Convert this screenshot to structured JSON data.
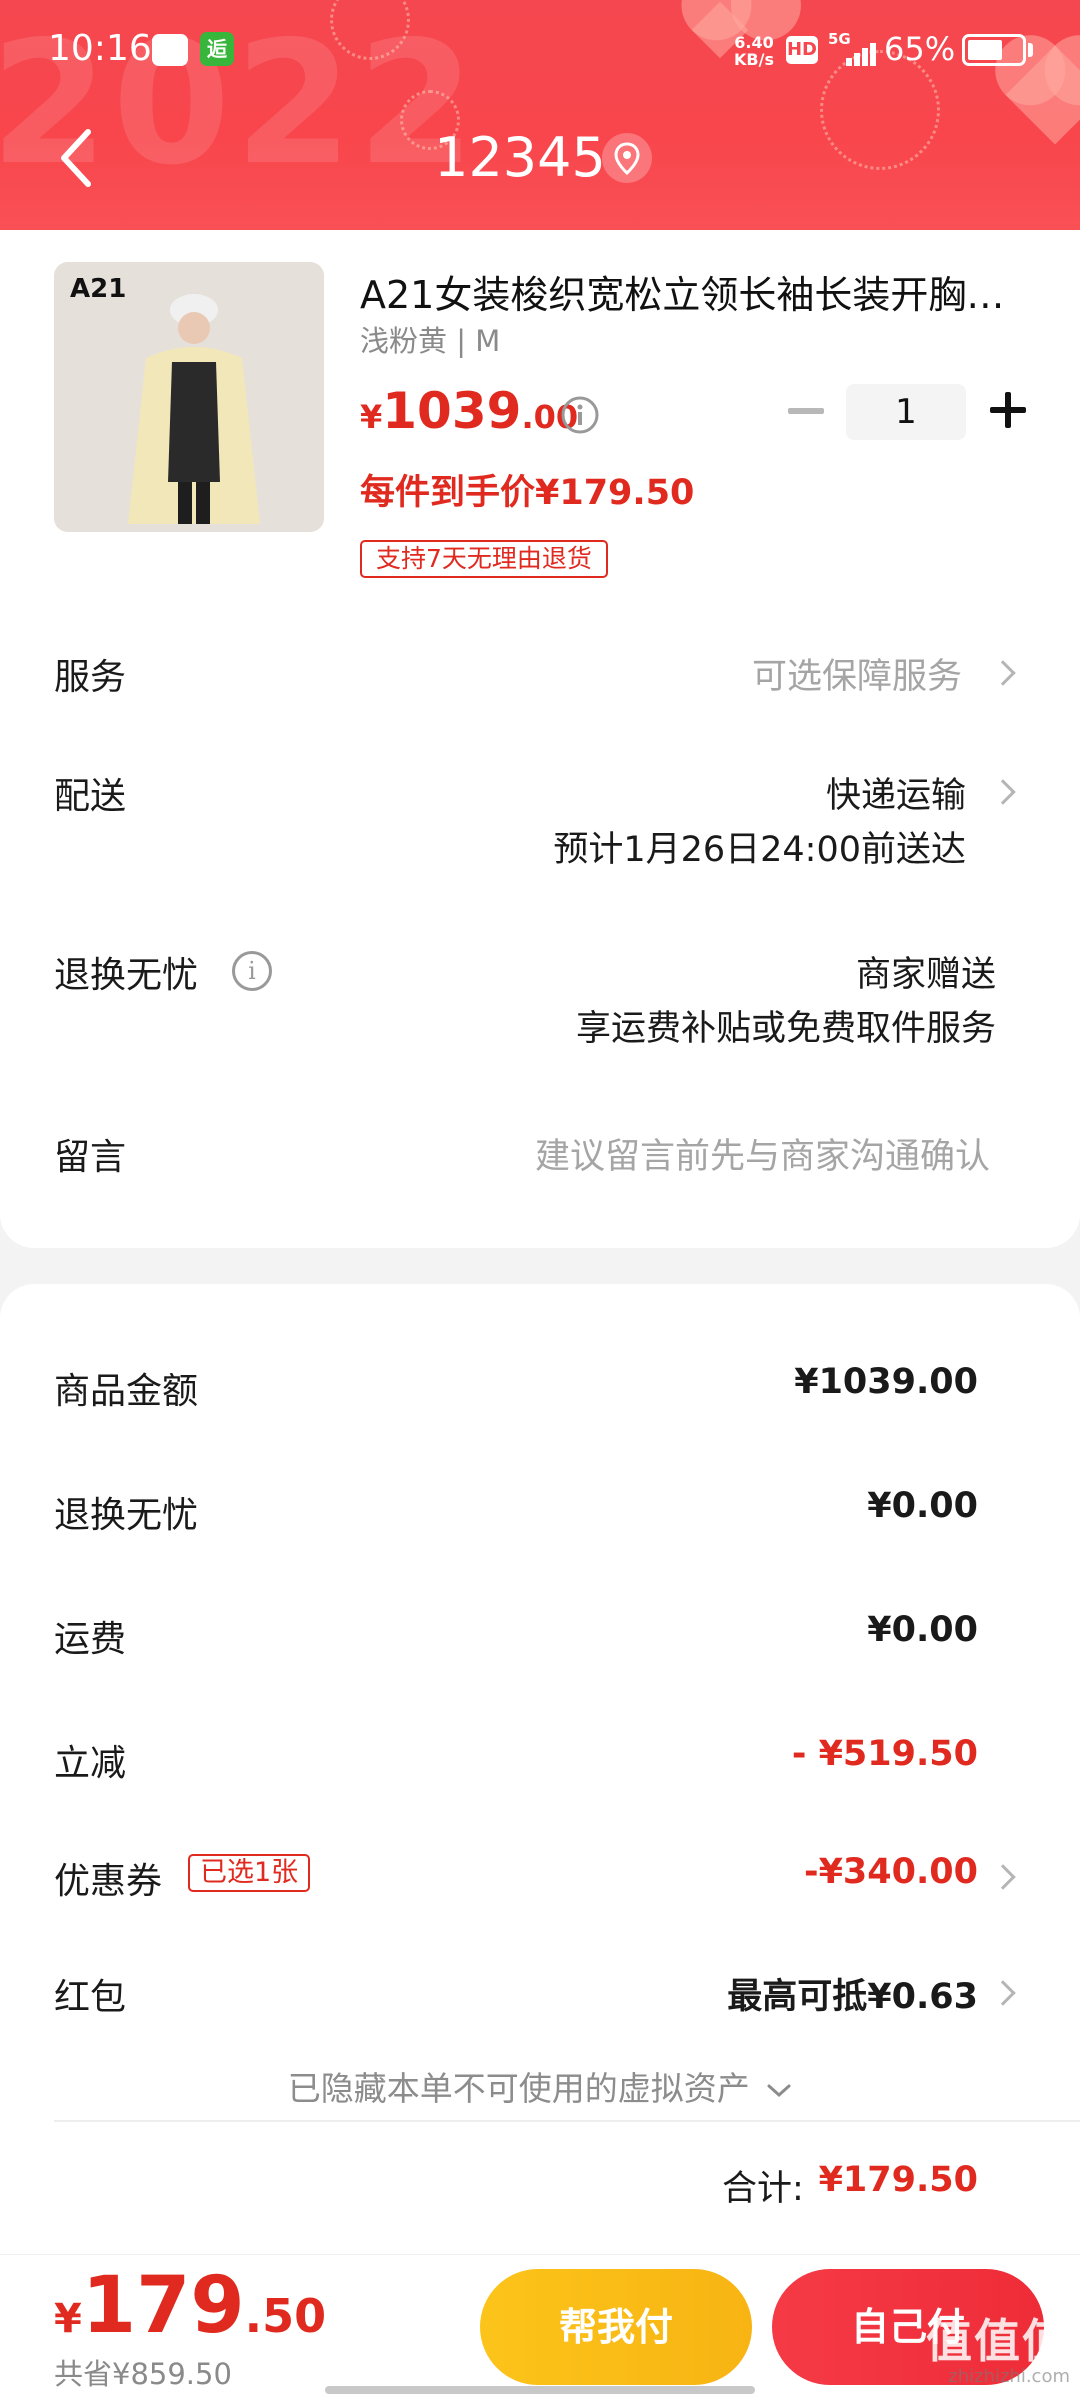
{
  "status_bar": {
    "time": "10:16",
    "speed_value": "6.40",
    "speed_unit": "KB/s",
    "hd": "HD",
    "network": "5G",
    "battery_pct": "65%",
    "battery_level": 0.65,
    "app2_label": "逅"
  },
  "header": {
    "title": "12345",
    "deco_text": "2022"
  },
  "product": {
    "brand_on_image": "A21",
    "title": "A21女装梭织宽松立领长袖长装开胸…",
    "spec": "浅粉黄 | M",
    "price_symbol": "¥",
    "price_int": "1039",
    "price_dec": ".00",
    "quantity": "1",
    "each_price": "每件到手价¥179.50",
    "return_tag": "支持7天无理由退货"
  },
  "options": {
    "service_label": "服务",
    "service_value": "可选保障服务",
    "delivery_label": "配送",
    "delivery_value": "快递运输",
    "delivery_eta": "预计1月26日24:00前送达",
    "worry_free_label": "退换无忧",
    "worry_free_value": "商家赠送",
    "worry_free_sub": "享运费补贴或免费取件服务",
    "message_label": "留言",
    "message_placeholder": "建议留言前先与商家沟通确认"
  },
  "summary": {
    "goods_label": "商品金额",
    "goods_value": "¥1039.00",
    "worry_label": "退换无忧",
    "worry_value": "¥0.00",
    "shipping_label": "运费",
    "shipping_value": "¥0.00",
    "discount_label": "立减",
    "discount_value": "- ¥519.50",
    "coupon_label": "优惠券",
    "coupon_badge": "已选1张",
    "coupon_value": "-¥340.00",
    "redpacket_label": "红包",
    "redpacket_value": "最高可抵¥0.63",
    "hidden_note": "已隐藏本单不可使用的虚拟资产",
    "total_label": "合计:",
    "total_value": "¥179.50"
  },
  "bottom_bar": {
    "price_symbol": "¥",
    "price_int": "179",
    "price_dec": ".50",
    "saved": "共省¥859.50",
    "help_pay": "帮我付",
    "self_pay": "自己付"
  },
  "watermark": {
    "glyphs": "值值值",
    "site": "zhizhizhi.com"
  },
  "colors": {
    "header_red": "#f5474f",
    "price_red": "#e02a1f",
    "help_button_yellow": "#fcc41a",
    "self_button_red": "#f53a46"
  }
}
